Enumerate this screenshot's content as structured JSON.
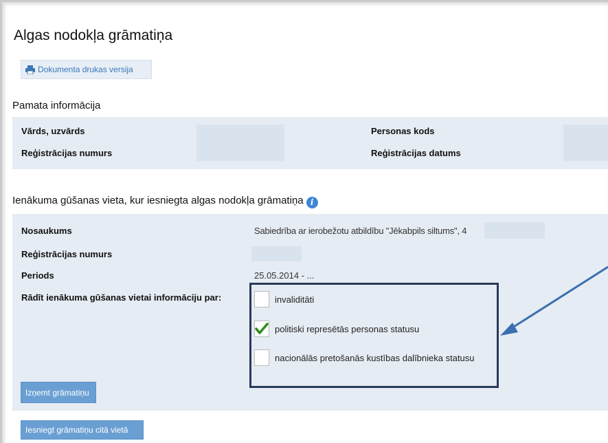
{
  "page": {
    "title": "Algas nodokļa grāmatiņa"
  },
  "toolbar": {
    "print_label": "Dokumenta drukas versija"
  },
  "basic": {
    "heading": "Pamata informācija",
    "name_label": "Vārds, uzvārds",
    "reg_no_label": "Reģistrācijas numurs",
    "personal_code_label": "Personas kods",
    "reg_date_label": "Reģistrācijas datums"
  },
  "income": {
    "heading": "Ienākuma gūšanas vieta, kur iesniegta algas nodokļa grāmatiņa",
    "name_label": "Nosaukums",
    "name_value": "Sabiedrība ar ierobežotu atbildību \"Jēkabpils siltums\", 4",
    "reg_no_label": "Reģistrācijas numurs",
    "period_label": "Periods",
    "period_value": "25.05.2014 - ...",
    "show_label": "Rādīt ienākuma gūšanas vietai informāciju par:",
    "options": [
      {
        "label": "invaliditāti",
        "checked": false
      },
      {
        "label": "politiski represētās personas statusu",
        "checked": true
      },
      {
        "label": "nacionālās pretošanās kustības dalībnieka statusu",
        "checked": false
      }
    ]
  },
  "buttons": {
    "take_out": "Izņemt grāmatiņu",
    "submit_elsewhere": "Iesniegt grāmatiņu citā vietā"
  },
  "colors": {
    "accent": "#3a78b8",
    "annotation": "#3a6fb0",
    "box": "#283a5a",
    "check": "#2e8b1a"
  }
}
